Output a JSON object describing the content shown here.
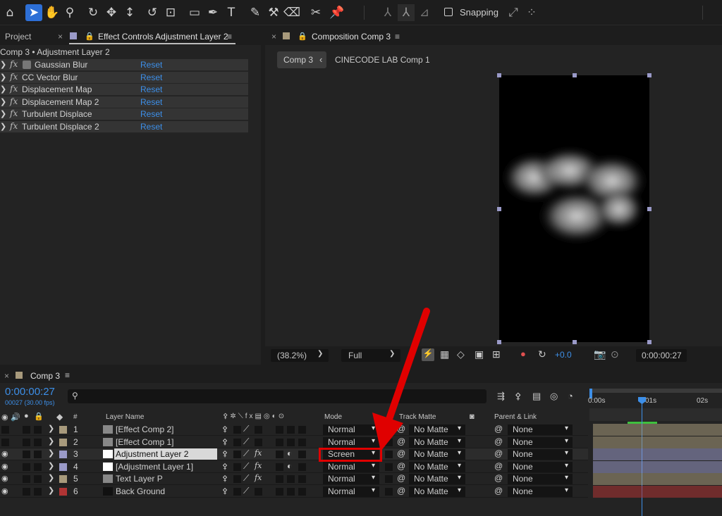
{
  "toolbar": {
    "snapping_label": "Snapping",
    "icons": [
      "home-icon",
      "selection-icon",
      "hand-icon",
      "zoom-icon",
      "orbit-icon",
      "pan-icon",
      "dolly-icon",
      "rotate-icon",
      "anchor-icon",
      "rectangle-icon",
      "pen-icon",
      "type-icon",
      "brush-icon",
      "clone-stamp-icon",
      "eraser-icon",
      "roto-brush-icon",
      "puppet-pin-icon"
    ]
  },
  "left_panel": {
    "project_tab": "Project",
    "effects_tab": "Effect Controls Adjustment Layer 2",
    "breadcrumb": "Comp 3 • Adjustment Layer 2",
    "reset_label": "Reset",
    "effects": [
      {
        "name": "Gaussian Blur"
      },
      {
        "name": "CC Vector Blur"
      },
      {
        "name": "Displacement Map"
      },
      {
        "name": "Displacement Map 2"
      },
      {
        "name": "Turbulent Displace"
      },
      {
        "name": "Turbulent Displace 2"
      }
    ]
  },
  "comp_panel": {
    "tab": "Composition Comp 3",
    "breadcrumb_current": "Comp 3",
    "breadcrumb_next": "CINECODE LAB Comp 1",
    "zoom": "(38.2%)",
    "resolution": "Full",
    "exposure": "+0.0",
    "timecode": "0:00:00:27"
  },
  "timeline": {
    "tab": "Comp 3",
    "timecode": "0:00:00:27",
    "frame_info": "00027 (30.00 fps)",
    "search_placeholder": "",
    "columns": {
      "num": "#",
      "layer_name": "Layer Name",
      "mode": "Mode",
      "track_matte": "Track Matte",
      "parent": "Parent & Link"
    },
    "ruler": [
      "0:00s",
      "01s",
      "02s"
    ],
    "layers": [
      {
        "num": "1",
        "name": "[Effect Comp 2]",
        "mode": "Normal",
        "matte": "No Matte",
        "parent": "None",
        "label_color": "#a89a7c"
      },
      {
        "num": "2",
        "name": "[Effect Comp 1]",
        "mode": "Normal",
        "matte": "No Matte",
        "parent": "None",
        "label_color": "#a89a7c"
      },
      {
        "num": "3",
        "name": "Adjustment Layer 2",
        "mode": "Screen",
        "matte": "No Matte",
        "parent": "None",
        "label_color": "#9a9ac8"
      },
      {
        "num": "4",
        "name": "[Adjustment Layer 1]",
        "mode": "Normal",
        "matte": "No Matte",
        "parent": "None",
        "label_color": "#9a9ac8"
      },
      {
        "num": "5",
        "name": "Text Layer P",
        "mode": "Normal",
        "matte": "No Matte",
        "parent": "None",
        "label_color": "#a89a7c"
      },
      {
        "num": "6",
        "name": "Back Ground",
        "mode": "Normal",
        "matte": "No Matte",
        "parent": "None",
        "label_color": "#b03434"
      }
    ]
  },
  "colors": {
    "accent": "#3d8fe8",
    "highlight": "#e00000"
  }
}
